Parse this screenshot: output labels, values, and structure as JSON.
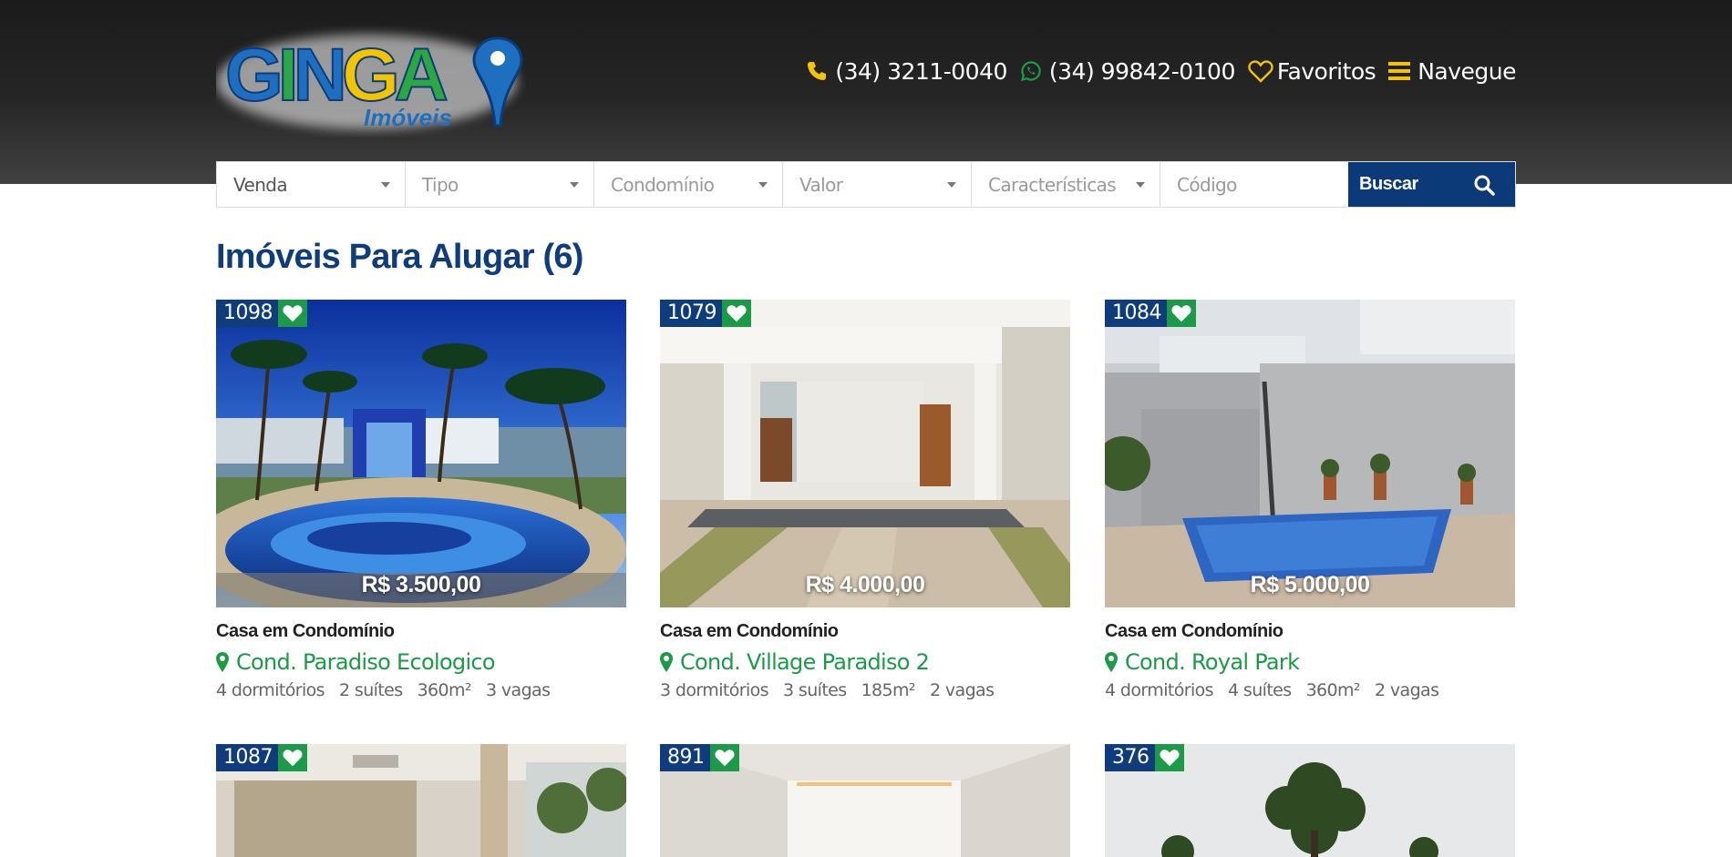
{
  "logo": {
    "text_main": "GINGA",
    "text_sub": "Imóveis"
  },
  "nav": {
    "phone": "(34) 3211-0040",
    "whatsapp": "(34) 99842-0100",
    "favorites": "Favoritos",
    "menu": "Navegue"
  },
  "search": {
    "mode": "Venda",
    "type_placeholder": "Tipo",
    "condo_placeholder": "Condomínio",
    "price_placeholder": "Valor",
    "features_placeholder": "Características",
    "code_placeholder": "Código",
    "button_label": "Buscar"
  },
  "title": "Imóveis Para Alugar (6)",
  "listings": [
    {
      "code": "1098",
      "price": "R$ 3.500,00",
      "type": "Casa em Condomínio",
      "location": "Cond. Paradiso Ecologico",
      "features": [
        "4 dormitórios",
        "2 suítes",
        "360m²",
        "3 vagas"
      ]
    },
    {
      "code": "1079",
      "price": "R$ 4.000,00",
      "type": "Casa em Condomínio",
      "location": "Cond. Village Paradiso 2",
      "features": [
        "3 dormitórios",
        "3 suítes",
        "185m²",
        "2 vagas"
      ]
    },
    {
      "code": "1084",
      "price": "R$ 5.000,00",
      "type": "Casa em Condomínio",
      "location": "Cond. Royal Park",
      "features": [
        "4 dormitórios",
        "4 suítes",
        "360m²",
        "2 vagas"
      ]
    },
    {
      "code": "1087"
    },
    {
      "code": "891"
    },
    {
      "code": "376"
    }
  ],
  "colors": {
    "brand_blue": "#0e3c7c",
    "brand_green": "#1b9b47",
    "accent_yellow": "#f5c400"
  }
}
